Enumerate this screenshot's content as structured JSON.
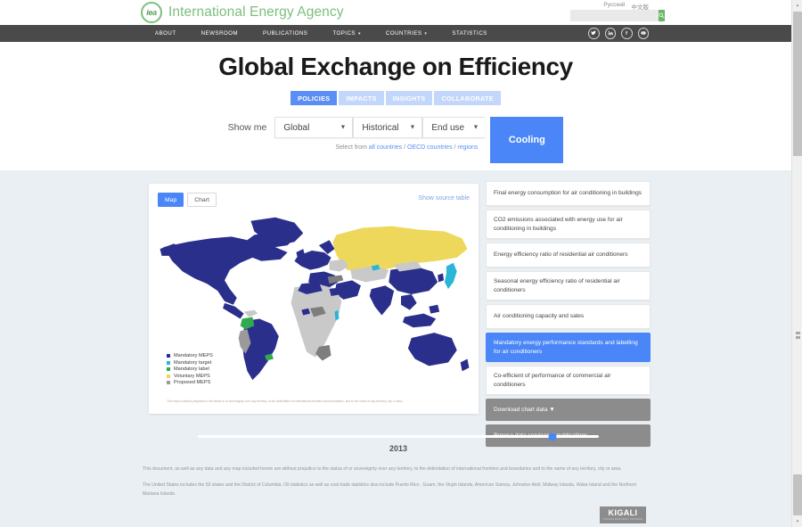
{
  "header": {
    "logo_text": "International Energy Agency",
    "logo_mark": "iea",
    "lang_ru": "Русский",
    "lang_zh": "中文版",
    "search_placeholder": "",
    "search_value": "",
    "search_icon": "search-icon",
    "nav": [
      {
        "label": "ABOUT",
        "caret": ""
      },
      {
        "label": "NEWSROOM",
        "caret": ""
      },
      {
        "label": "PUBLICATIONS",
        "caret": ""
      },
      {
        "label": "TOPICS",
        "caret": "▾"
      },
      {
        "label": "COUNTRIES",
        "caret": "▾"
      },
      {
        "label": "STATISTICS",
        "caret": ""
      }
    ],
    "social": [
      {
        "name": "twitter-icon"
      },
      {
        "name": "linkedin-icon"
      },
      {
        "name": "facebook-icon"
      },
      {
        "name": "youtube-icon"
      }
    ]
  },
  "hero": {
    "title": "Global Exchange on Efficiency",
    "pills": [
      {
        "label": "POLICIES",
        "active": true
      },
      {
        "label": "IMPACTS",
        "active": false
      },
      {
        "label": "INSIGHTS",
        "active": false
      },
      {
        "label": "COLLABORATE",
        "active": false
      }
    ]
  },
  "filters": {
    "show_me_label": "Show me",
    "scope": "Global",
    "period": "Historical",
    "category": "End use",
    "cooling_button": "Cooling",
    "select_from_prefix": "Select from ",
    "link_all_countries": "all countries",
    "sep1": " / ",
    "link_oecd": "OECD countries",
    "sep2": " / ",
    "link_regions": "regions",
    "dropdown_arrow": "▼"
  },
  "map_card": {
    "tab_map": "Map",
    "tab_chart": "Chart",
    "show_source_table": "Show source table",
    "legend": [
      {
        "label": "Mandatory MEPS",
        "color": "#2b2f8c"
      },
      {
        "label": "Mandatory target",
        "color": "#29b6d8"
      },
      {
        "label": "Mandatory label",
        "color": "#2faa4e"
      },
      {
        "label": "Voluntary MEPS",
        "color": "#edd85c"
      },
      {
        "label": "Proposed MEPS",
        "color": "#9a9a9a"
      }
    ],
    "disclaimer": "This map is without prejudice to the status of or sovereignty over any territory, to the delimitation of international frontiers and boundaries, and to the name of any territory, city or area.",
    "colors": {
      "mandatory_meps": "#2b2f8c",
      "mandatory_target": "#29b6d8",
      "mandatory_label": "#2faa4e",
      "voluntary_meps": "#edd85c",
      "proposed_meps": "#9a9a9a",
      "no_data": "#c9c9c9"
    }
  },
  "indicator_list": [
    {
      "label": "Final energy consumption for air conditioning in buildings",
      "state": "normal"
    },
    {
      "label": "CO2 emissions associated with energy use for air conditioning in buildings",
      "state": "normal"
    },
    {
      "label": "Energy efficiency ratio of residential air conditioners",
      "state": "normal"
    },
    {
      "label": "Seasonal energy efficiency ratio of residential air conditioners",
      "state": "normal"
    },
    {
      "label": "Air conditioning capacity and sales",
      "state": "normal"
    },
    {
      "label": "Mandatory energy performance standards and labelling for air conditioners",
      "state": "selected"
    },
    {
      "label": "Co-efficient of performance of commercial air conditioners",
      "state": "normal"
    },
    {
      "label": "Download chart data ▼",
      "state": "action"
    },
    {
      "label": "Browse data services & publications",
      "state": "action"
    }
  ],
  "timeline": {
    "year": "2013",
    "position_percent": 88.5
  },
  "footer": {
    "note1": "This document, as well as any data and any map included herein are without prejudice to the status of or sovereignty over any territory, to the delimitation of international frontiers and boundaries and to the name of any territory, city or area.",
    "note2": "The United States includes the 50 states and the District of Columbia. Oil statistics as well as coal trade statistics also include Puerto Rico , Guam, the Virgin Islands, American Samoa, Johnston Atoll, Midway Islands, Wake Island and the Northern Mariana Islands."
  },
  "badge": {
    "title": "KIGALI",
    "subtitle": "COOLING EFFICIENCY PROGRAM"
  },
  "scrollbar": {
    "up_arrow": "▴",
    "down_arrow": "▾"
  }
}
